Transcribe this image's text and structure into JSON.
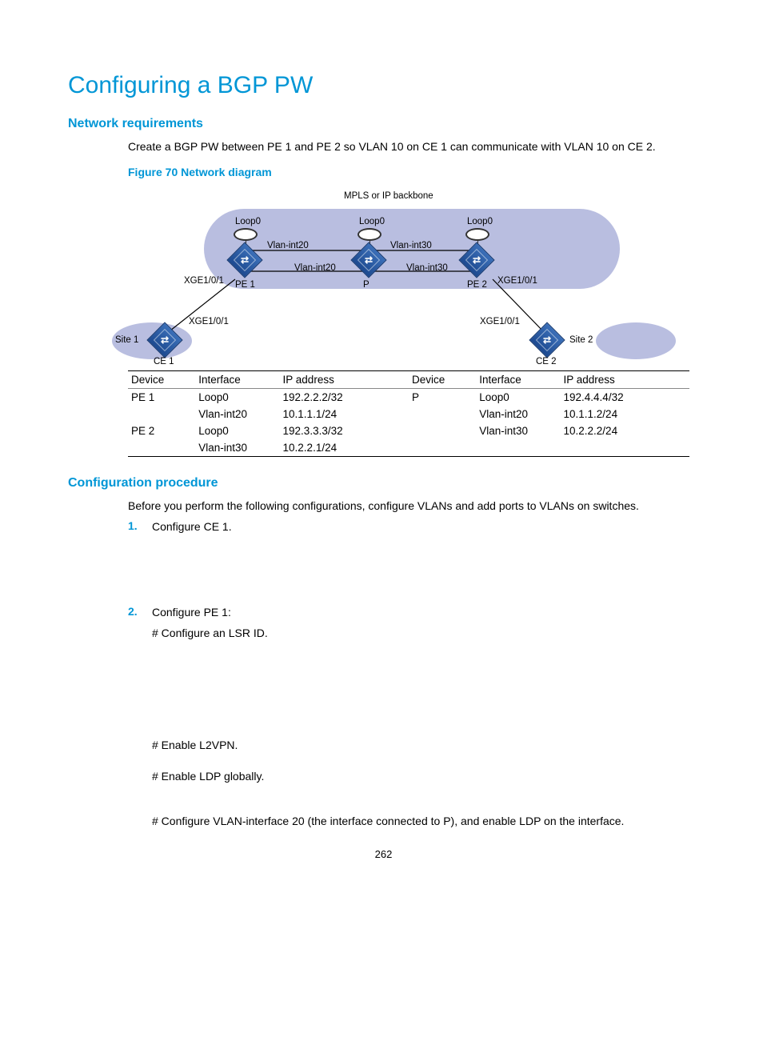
{
  "title": "Configuring a BGP PW",
  "sections": {
    "netreq_heading": "Network requirements",
    "netreq_text": "Create a BGP PW between PE 1 and PE 2 so VLAN 10 on CE 1 can communicate with VLAN 10 on CE 2.",
    "fig_caption": "Figure 70 Network diagram",
    "confproc_heading": "Configuration procedure",
    "confproc_intro": "Before you perform the following configurations, configure VLANs and add ports to VLANs on switches."
  },
  "diagram": {
    "backbone_label": "MPLS or IP backbone",
    "nodes": {
      "pe1": "PE 1",
      "p": "P",
      "pe2": "PE 2",
      "ce1": "CE 1",
      "ce2": "CE 2"
    },
    "sites": {
      "s1": "Site 1",
      "s2": "Site 2"
    },
    "loop": "Loop0",
    "links": {
      "vint20": "Vlan-int20",
      "vint30": "Vlan-int30",
      "xge": "XGE1/0/1"
    }
  },
  "table": {
    "headers": [
      "Device",
      "Interface",
      "IP address",
      "Device",
      "Interface",
      "IP address"
    ],
    "rows": [
      [
        "PE 1",
        "Loop0",
        "192.2.2.2/32",
        "P",
        "Loop0",
        "192.4.4.4/32"
      ],
      [
        "",
        "Vlan-int20",
        "10.1.1.1/24",
        "",
        "Vlan-int20",
        "10.1.1.2/24"
      ],
      [
        "PE 2",
        "Loop0",
        "192.3.3.3/32",
        "",
        "Vlan-int30",
        "10.2.2.2/24"
      ],
      [
        "",
        "Vlan-int30",
        "10.2.2.1/24",
        "",
        "",
        ""
      ]
    ]
  },
  "procedure": {
    "step1": "Configure CE 1.",
    "step2": "Configure PE 1:",
    "step2_a": "# Configure an LSR ID.",
    "step2_b": "# Enable L2VPN.",
    "step2_c": "# Enable LDP globally.",
    "step2_d": "# Configure VLAN-interface 20 (the interface connected to P), and enable LDP on the interface."
  },
  "page_number": "262"
}
